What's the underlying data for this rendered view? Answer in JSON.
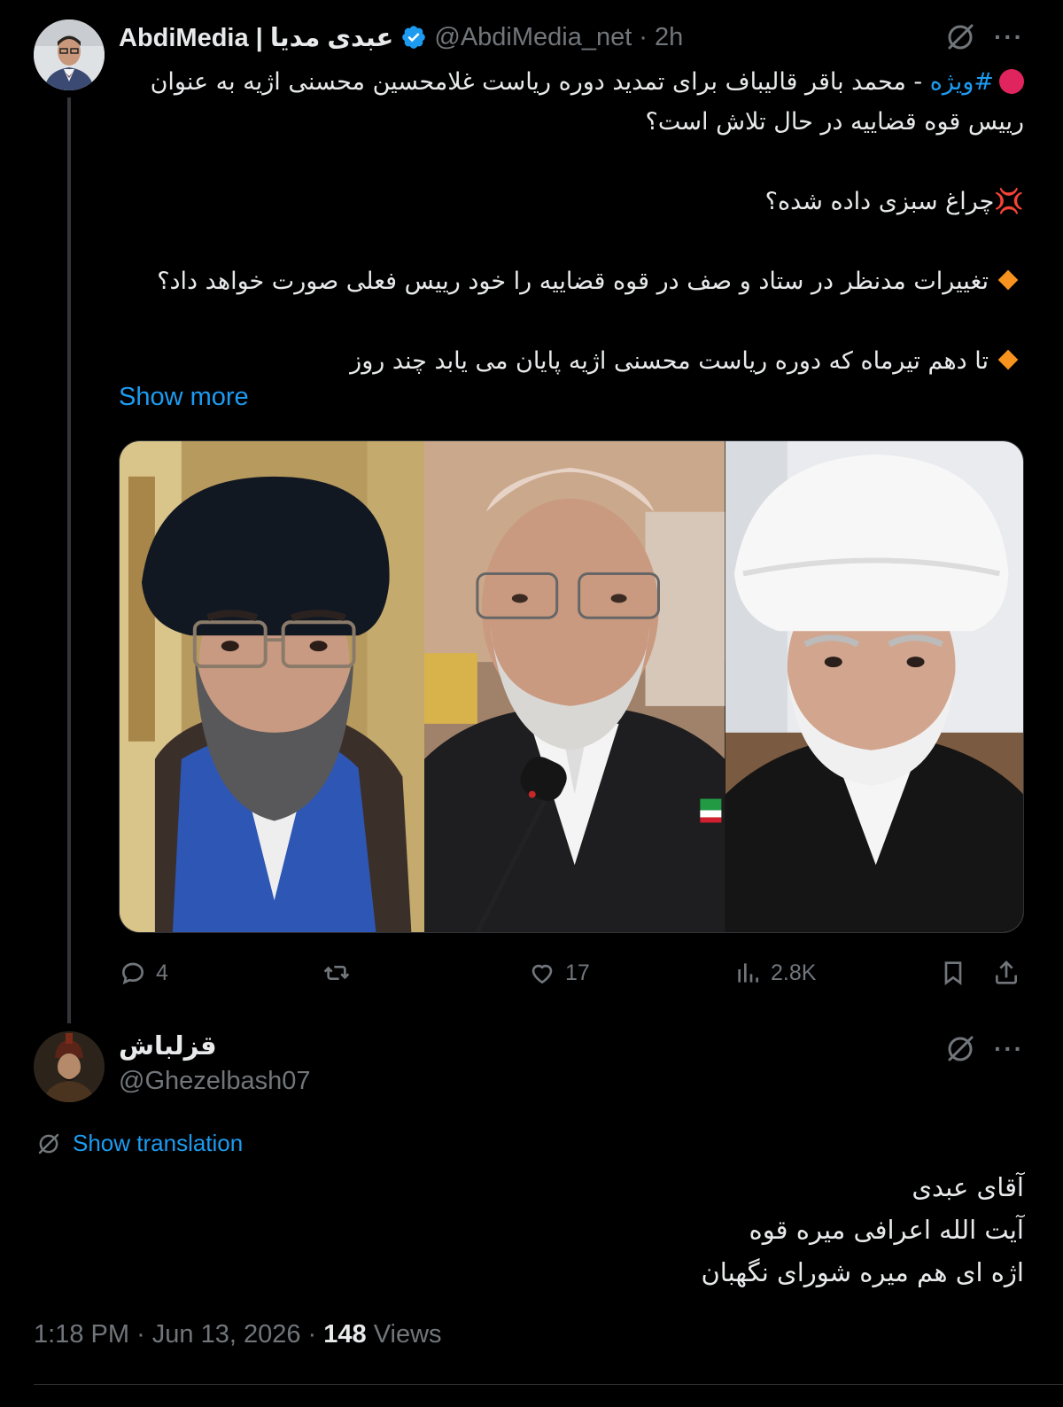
{
  "tweet": {
    "display_name": "AbdiMedia | عبدی مدیا",
    "handle": "@AbdiMedia_net",
    "separator": "·",
    "time": "2h",
    "hashtag": "#ویژه",
    "line1": " - محمد باقر قالیباف برای تمدید دوره ریاست غلامحسین محسنی اژیه به عنوان رییس قوه قضاییه در حال تلاش است؟",
    "line2": "چراغ سبزی داده شده؟",
    "line3": "تغییرات مدنظر در ستاد و صف در قوه قضاییه را خود رییس فعلی صورت خواهد داد؟",
    "line4": "تا دهم تیرماه که دوره ریاست محسنی اژیه پایان می یابد چند روز",
    "show_more": "Show more",
    "actions": {
      "replies": "4",
      "likes": "17",
      "views": "2.8K"
    }
  },
  "reply": {
    "display_name": "قزلباش",
    "handle": "@Ghezelbash07",
    "translate_label": "Show translation",
    "lines": [
      "آقای عبدی",
      "آیت الله اعرافی میره قوه",
      "اژه ای هم میره شورای نگهبان"
    ],
    "time": "1:18 PM",
    "date": "Jun 13, 2026",
    "views_count": "148",
    "views_label": "Views"
  },
  "colors": {
    "accent": "#1d9bf0",
    "muted": "#71767b",
    "text": "#e7e9ea",
    "background": "#000000"
  }
}
